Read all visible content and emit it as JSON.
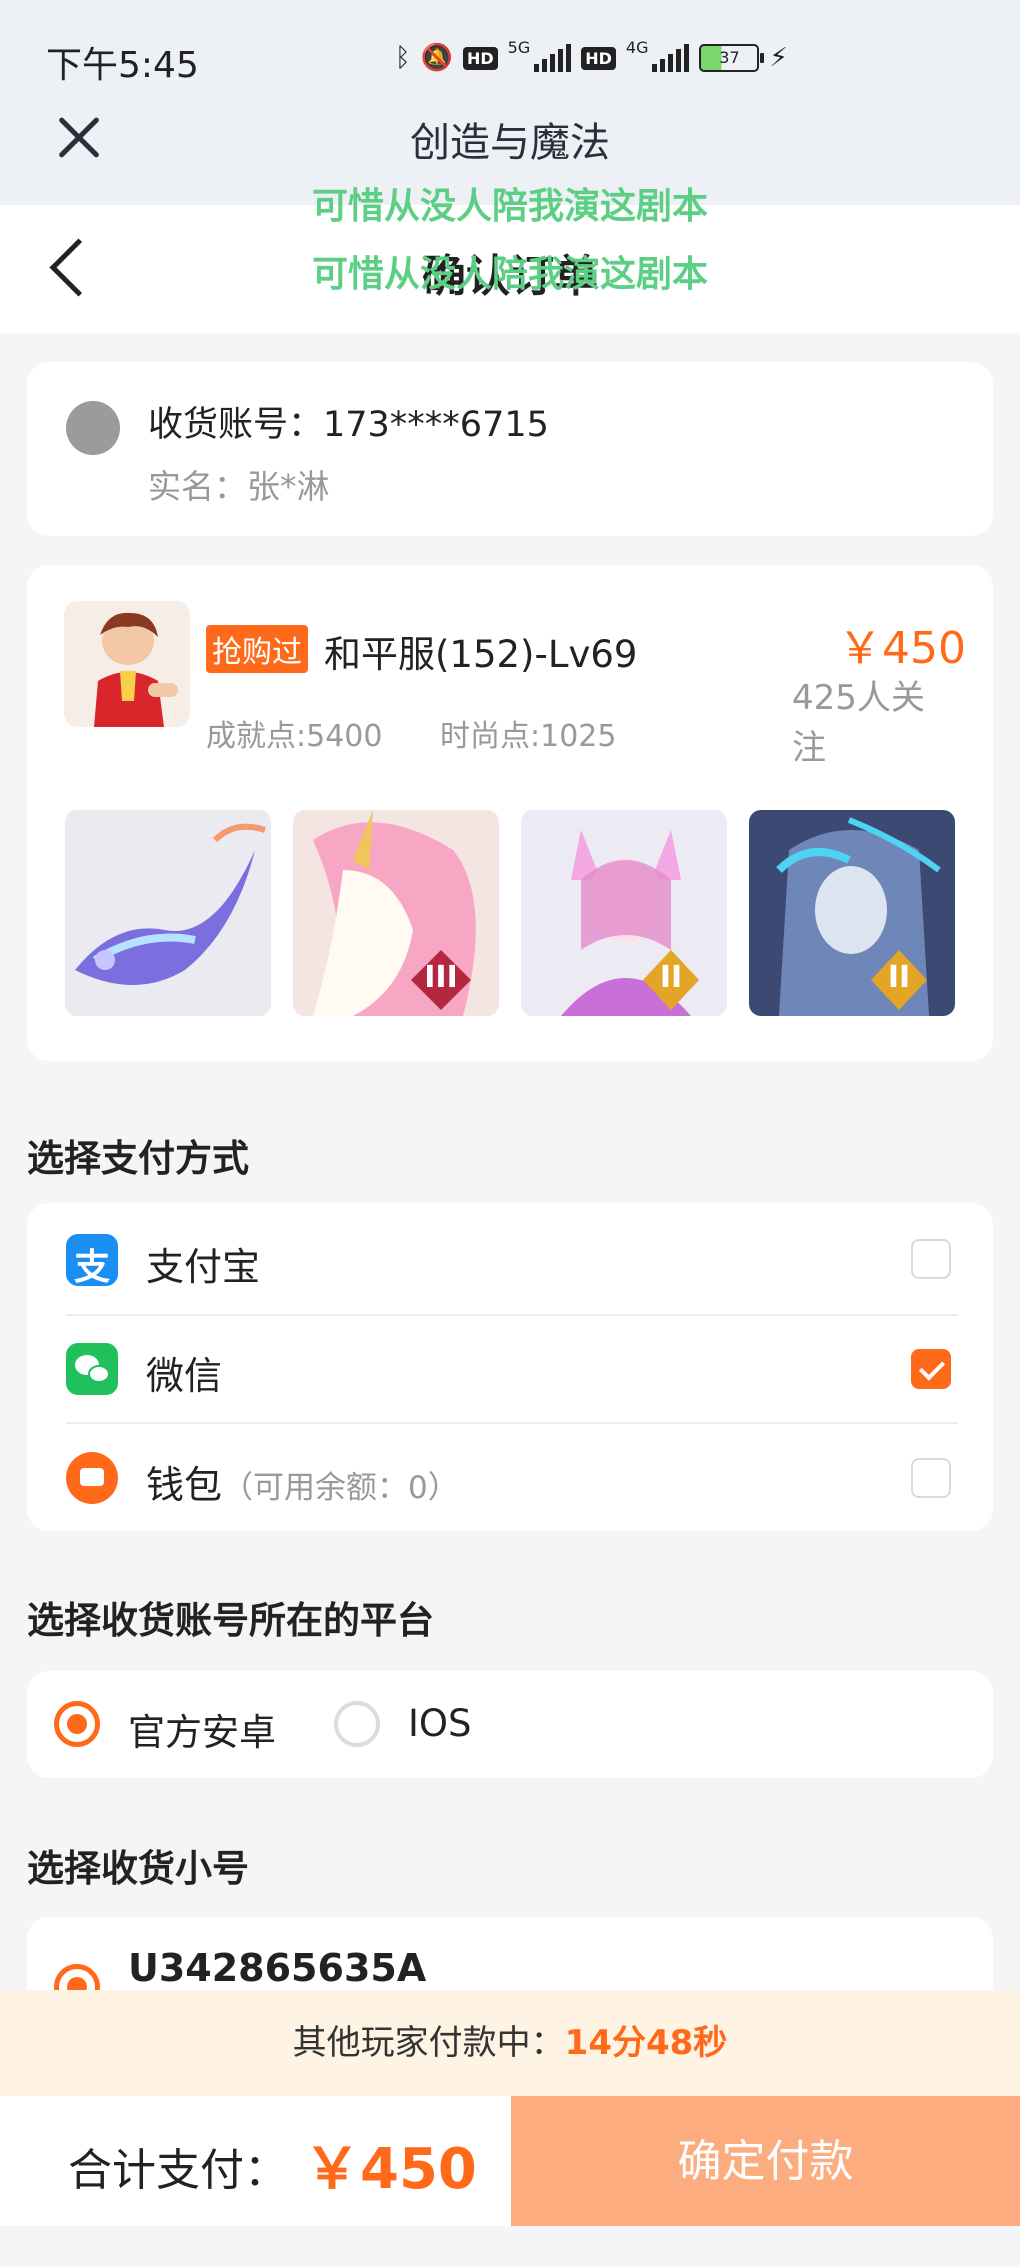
{
  "status_bar": {
    "time": "下午5:45",
    "net5g": "5G",
    "net4g": "4G",
    "hd": "HD",
    "battery": "37"
  },
  "app": {
    "title": "创造与魔法"
  },
  "page": {
    "title": "确认订单"
  },
  "overlay_lyric": "可惜从没人陪我演这剧本",
  "account": {
    "label": "收货账号：173****6715",
    "realname": "实名：张*淋"
  },
  "product": {
    "badge": "抢购过",
    "name": "和平服(152)-Lv69",
    "price": "￥450",
    "followers": "425人关注",
    "achievement": "成就点:5400",
    "fashion": "时尚点:1025",
    "thumbnail_ranks": [
      "",
      "III",
      "II",
      "II"
    ]
  },
  "payment": {
    "section_title": "选择支付方式",
    "methods": [
      {
        "label": "支付宝",
        "sub": "",
        "icon": "alipay-icon",
        "checked": false
      },
      {
        "label": "微信",
        "sub": "",
        "icon": "wechat-icon",
        "checked": true
      },
      {
        "label": "钱包",
        "sub": "（可用余额：0）",
        "icon": "wallet-icon",
        "checked": false
      }
    ]
  },
  "platform": {
    "section_title": "选择收货账号所在的平台",
    "options": [
      "官方安卓",
      "IOS"
    ],
    "selected": "官方安卓"
  },
  "sub_account": {
    "section_title": "选择收货小号",
    "name": "U342865635A"
  },
  "countdown": {
    "prefix": "其他玩家付款中：",
    "time": "14分48秒"
  },
  "footer": {
    "total_label": "合计支付：",
    "total_value": "￥450",
    "pay_button": "确定付款"
  },
  "colors": {
    "accent": "#ff6a1a",
    "button_disabled": "#fdac80",
    "lyric": "#5ccf85"
  }
}
